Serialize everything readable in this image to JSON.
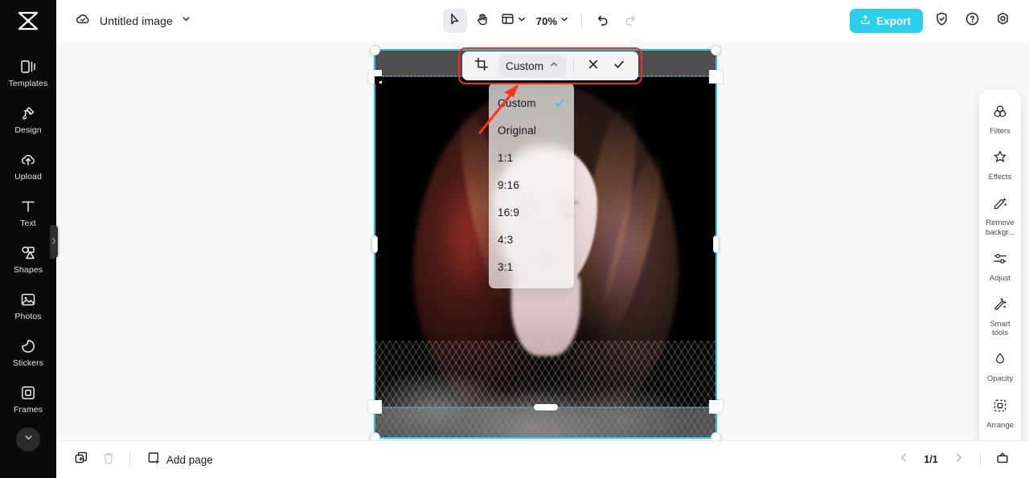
{
  "app": {
    "logo": "capcut-logo",
    "document_title": "Untitled image",
    "cloud_icon": "cloud-check-icon",
    "title_chevron": "chevron-down-icon"
  },
  "toolbar": {
    "select_tool": "cursor-arrow-icon",
    "hand_tool": "hand-icon",
    "canvas_tool": "canvas-layout-icon",
    "canvas_chevron": "chevron-down-icon",
    "zoom_level": "70%",
    "zoom_chevron": "chevron-down-icon",
    "undo": "undo-icon",
    "redo": "redo-icon",
    "export_label": "Export",
    "export_icon": "upload-icon",
    "shield_icon": "shield-check-icon",
    "help_icon": "question-circle-icon",
    "settings_icon": "gear-icon",
    "export_color": "#29d0ec"
  },
  "left_sidebar": {
    "items": [
      {
        "label": "Templates",
        "icon": "templates-icon"
      },
      {
        "label": "Design",
        "icon": "design-icon"
      },
      {
        "label": "Upload",
        "icon": "upload-cloud-icon"
      },
      {
        "label": "Text",
        "icon": "text-icon"
      },
      {
        "label": "Shapes",
        "icon": "shapes-icon"
      },
      {
        "label": "Photos",
        "icon": "photos-icon"
      },
      {
        "label": "Stickers",
        "icon": "stickers-icon"
      },
      {
        "label": "Frames",
        "icon": "frames-icon"
      }
    ],
    "more_icon": "chevron-down-icon",
    "collapse_handle": "chevron-right-icon"
  },
  "crop_toolbar": {
    "crop_icon": "crop-icon",
    "ratio_value": "Custom",
    "ratio_chevron": "chevron-up-icon",
    "cancel_icon": "close-x-icon",
    "confirm_icon": "check-icon",
    "highlight_color": "#f9331f"
  },
  "ratio_menu": {
    "selected": "Custom",
    "check_color": "#22c8e8",
    "options": [
      {
        "label": "Custom",
        "checked": true
      },
      {
        "label": "Original",
        "checked": false
      },
      {
        "label": "1:1",
        "checked": false
      },
      {
        "label": "9:16",
        "checked": false
      },
      {
        "label": "16:9",
        "checked": false
      },
      {
        "label": "4:3",
        "checked": false
      },
      {
        "label": "3:1",
        "checked": false
      }
    ]
  },
  "right_panel": {
    "items": [
      {
        "label": "Filters",
        "icon": "filters-icon"
      },
      {
        "label": "Effects",
        "icon": "effects-sparkle-icon"
      },
      {
        "label": "Remove backgr...",
        "icon": "remove-background-icon"
      },
      {
        "label": "Adjust",
        "icon": "sliders-icon"
      },
      {
        "label": "Smart tools",
        "icon": "magic-wand-icon"
      },
      {
        "label": "Opacity",
        "icon": "droplet-icon"
      },
      {
        "label": "Arrange",
        "icon": "arrange-icon"
      }
    ]
  },
  "canvas": {
    "selection_color": "#22c8e8",
    "image_alt": "Portrait of a woman with long wavy brown hair on a black background wearing a black lace top",
    "crop_overlay_color": "rgba(128,128,128,0.62)"
  },
  "bottom_bar": {
    "duplicate_icon": "duplicate-page-icon",
    "delete_icon": "trash-icon",
    "add_page_icon": "add-page-icon",
    "add_page_label": "Add page",
    "prev_icon": "chevron-left-icon",
    "page_indicator": "1/1",
    "next_icon": "chevron-right-icon",
    "present_icon": "present-icon"
  }
}
